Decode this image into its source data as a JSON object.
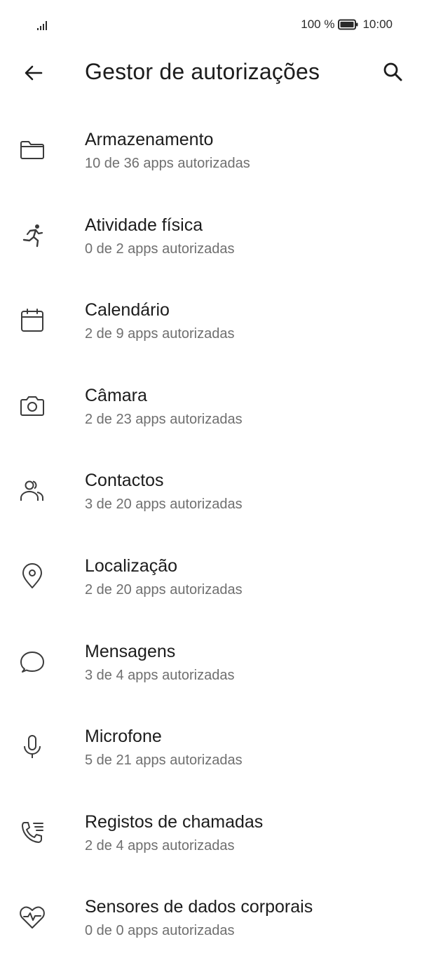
{
  "status_bar": {
    "battery_percent": "100 %",
    "time": "10:00",
    "signal_icon": "signal-bars-icon",
    "battery_icon": "battery-full-icon"
  },
  "app_bar": {
    "title": "Gestor de autorizações",
    "back_icon": "arrow-back-icon",
    "search_icon": "search-icon"
  },
  "permissions": [
    {
      "icon": "folder-icon",
      "title": "Armazenamento",
      "subtitle": "10 de 36 apps autorizadas"
    },
    {
      "icon": "running-person-icon",
      "title": "Atividade física",
      "subtitle": "0 de 2 apps autorizadas"
    },
    {
      "icon": "calendar-icon",
      "title": "Calendário",
      "subtitle": "2 de 9 apps autorizadas"
    },
    {
      "icon": "camera-icon",
      "title": "Câmara",
      "subtitle": "2 de 23 apps autorizadas"
    },
    {
      "icon": "contacts-icon",
      "title": "Contactos",
      "subtitle": "3 de 20 apps autorizadas"
    },
    {
      "icon": "location-pin-icon",
      "title": "Localização",
      "subtitle": "2 de 20 apps autorizadas"
    },
    {
      "icon": "message-bubble-icon",
      "title": "Mensagens",
      "subtitle": "3 de 4 apps autorizadas"
    },
    {
      "icon": "microphone-icon",
      "title": "Microfone",
      "subtitle": "5 de 21 apps autorizadas"
    },
    {
      "icon": "call-log-icon",
      "title": "Registos de chamadas",
      "subtitle": "2 de 4 apps autorizadas"
    },
    {
      "icon": "heart-rate-icon",
      "title": "Sensores de dados corporais",
      "subtitle": "0 de 0 apps autorizadas"
    }
  ]
}
